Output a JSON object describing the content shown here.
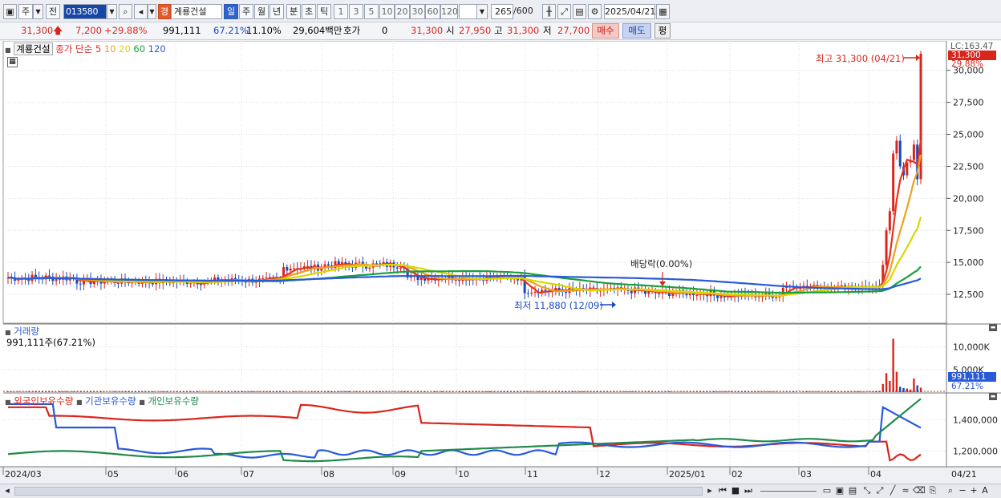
{
  "toolbar": {
    "market_label": "주",
    "prev_label": "전",
    "stock_code": "013580",
    "stock_name": "계룡건설",
    "stock_badge": "경",
    "periods": [
      "일",
      "주",
      "월",
      "년",
      "분",
      "초",
      "틱"
    ],
    "active_period": "일",
    "minute_options": [
      "1",
      "3",
      "5",
      "10",
      "20",
      "30",
      "60",
      "120"
    ],
    "count_value": "265",
    "count_max": "/600",
    "date_value": "2025/04/21"
  },
  "quote": {
    "price": "31,300",
    "change": "7,200",
    "change_pct": "+29.88%",
    "volume": "991,111",
    "volume_ratio": "67.21%",
    "turnover": "11.10%",
    "amount": "29,604백만",
    "hoga_label": "호가",
    "hoga_value": "0",
    "hoga_price": "31,300",
    "open_label": "시",
    "open_value": "27,950",
    "high_label": "고",
    "high_value": "31,300",
    "low_label": "저",
    "low_value": "27,700",
    "buy_label": "매수",
    "sell_label": "매도",
    "eq_label": "평"
  },
  "price_panel": {
    "title": "계룡건설",
    "ma_label": "종가 단순",
    "ma_periods": [
      {
        "period": "5",
        "color": "#e8331e"
      },
      {
        "period": "10",
        "color": "#f0a020"
      },
      {
        "period": "20",
        "color": "#d8d800"
      },
      {
        "period": "60",
        "color": "#19a03a"
      },
      {
        "period": "120",
        "color": "#2a5ad8"
      }
    ],
    "ticks": [
      "30,000",
      "27,500",
      "25,000",
      "22,500",
      "20,000",
      "17,500",
      "15,000",
      "12,500"
    ],
    "lc_label": "LC:163.47",
    "price_tag": "31,300",
    "pct_tag": "29.88%",
    "high_annot": "최고 31,300 (04/21)",
    "low_annot": "최저 11,880 (12/09)",
    "div_annot": "배당락(0.00%)"
  },
  "volume_panel": {
    "title": "거래량",
    "value": "991,111주(67.21%)",
    "ticks": [
      "10,000K",
      "5,000K"
    ],
    "tag_value": "991,111",
    "tag_pct": "67.21%"
  },
  "holding_panel": {
    "series": [
      {
        "name": "외국인보유수량",
        "color": "#d9261c"
      },
      {
        "name": "기관보유수량",
        "color": "#2a5ad8"
      },
      {
        "name": "개인보유수량",
        "color": "#1f8a4c"
      }
    ],
    "ticks": [
      "1,400,000",
      "1,200,000"
    ]
  },
  "x_axis": {
    "labels": [
      "2024/03",
      "05",
      "06",
      "07",
      "08",
      "09",
      "10",
      "11",
      "12",
      "2025/01",
      "02",
      "03",
      "04"
    ],
    "right_label": "04/21"
  },
  "colors": {
    "up": "#d9261c",
    "down": "#1747c0",
    "grid": "#d9dde6"
  }
}
